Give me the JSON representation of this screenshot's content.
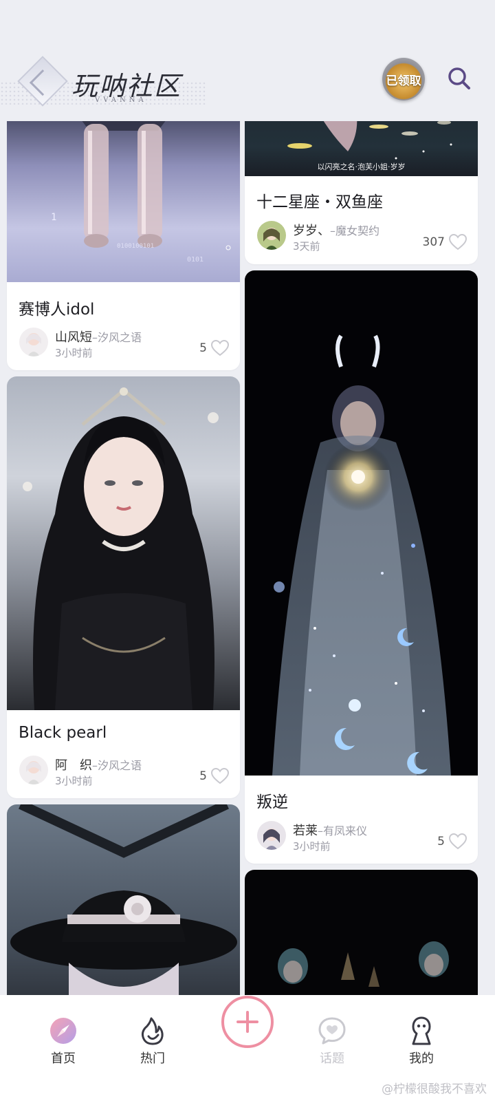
{
  "header": {
    "title": "玩呐社区",
    "subtitle": "VVANNA",
    "claimed_badge": "已领取",
    "search_icon": "search-icon"
  },
  "feed": {
    "left": [
      {
        "title": "赛博人idol",
        "author": "山风短",
        "guild": "–汐风之语",
        "time": "3小时前",
        "likes": "5"
      },
      {
        "title": "Black pearl",
        "author": "阿　织",
        "guild": "–汐风之语",
        "time": "3小时前",
        "likes": "5"
      },
      {
        "title": "",
        "author": "",
        "guild": "",
        "time": "",
        "likes": ""
      }
    ],
    "right": [
      {
        "title": "十二星座・双鱼座",
        "author": "岁岁、",
        "guild": "–魔女契约",
        "time": "3天前",
        "likes": "307",
        "image_caption": "以闪亮之名·泡芙小姐·岁岁"
      },
      {
        "title": "叛逆",
        "author": "若莱",
        "guild": "–有凤来仪",
        "time": "3小时前",
        "likes": "5"
      }
    ]
  },
  "bottom_nav": {
    "items": [
      {
        "label": "首页",
        "icon": "compass-icon",
        "active": true
      },
      {
        "label": "热门",
        "icon": "flame-icon",
        "active": false
      },
      {
        "label": "话题",
        "icon": "chat-heart-icon",
        "active": false,
        "disabled": true
      },
      {
        "label": "我的",
        "icon": "profile-icon",
        "active": false
      }
    ],
    "create_icon": "plus-icon"
  },
  "watermark": "@柠檬很酸我不喜欢",
  "colors": {
    "background": "#edeef3",
    "accent_pink": "#ee8fa2",
    "search_purple": "#5b4a86",
    "heart_outline": "#c9c9cf"
  }
}
